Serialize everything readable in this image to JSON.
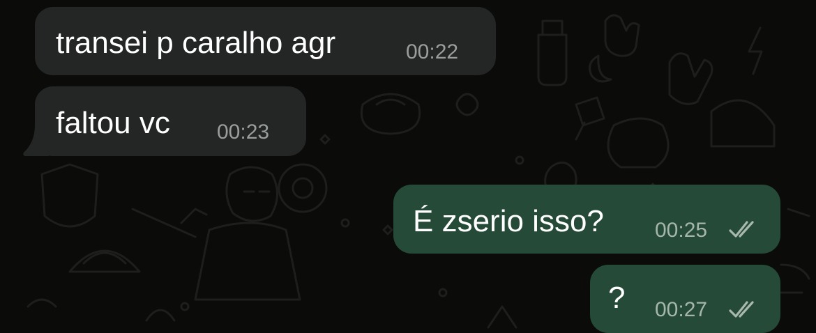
{
  "colors": {
    "background": "#0b0b0a",
    "incoming_bubble": "#242625",
    "outgoing_bubble": "#254a37",
    "message_text": "#ffffff",
    "timestamp": "#9a9e9b",
    "read_receipt": "#a9b8ae"
  },
  "chat": {
    "messages": [
      {
        "direction": "incoming",
        "text": "transei p caralho agr",
        "time": "00:22"
      },
      {
        "direction": "incoming",
        "text": "faltou vc",
        "time": "00:23"
      },
      {
        "direction": "outgoing",
        "text": "É zserio isso?",
        "time": "00:25",
        "status_icon": "double-check-icon"
      },
      {
        "direction": "outgoing",
        "text": "?",
        "time": "00:27",
        "status_icon": "double-check-icon"
      }
    ]
  }
}
